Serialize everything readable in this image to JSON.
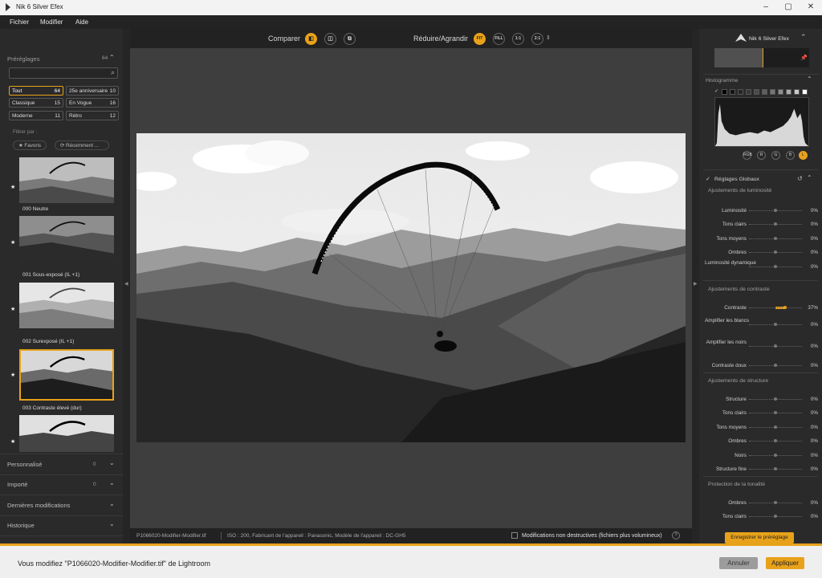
{
  "window": {
    "title": "Nik 6 Silver Efex"
  },
  "menu": [
    "Fichier",
    "Modifier",
    "Aide"
  ],
  "toolbar": {
    "compare_label": "Comparer",
    "zoom_label": "Réduire/Agrandir",
    "zoom_buttons": [
      "FIT",
      "FILL",
      "1:1",
      "2:1"
    ]
  },
  "presets": {
    "title": "Préréglages",
    "count": "64",
    "search_placeholder": "",
    "categories": [
      {
        "label": "Tout",
        "count": "64"
      },
      {
        "label": "25e anniversaire",
        "count": "10"
      },
      {
        "label": "Classique",
        "count": "15"
      },
      {
        "label": "En Vogue",
        "count": "16"
      },
      {
        "label": "Moderne",
        "count": "11"
      },
      {
        "label": "Rétro",
        "count": "12"
      }
    ],
    "filter_label": "Filtrer par :",
    "filter_favorites": "★ Favoris",
    "filter_recent": "⟳ Récemment ...",
    "items": [
      "000 Neutre",
      "001 Sous-exposé (IL +1)",
      "002 Surexposé (IL +1)",
      "003 Contraste élevé (dur)"
    ],
    "sections": [
      {
        "label": "Personnalisé",
        "count": "0"
      },
      {
        "label": "Importé",
        "count": "0"
      },
      {
        "label": "Dernières modifications",
        "count": ""
      },
      {
        "label": "Historique",
        "count": ""
      }
    ]
  },
  "status": {
    "filename": "P1066020-Modifier-Modifier.tif",
    "exif": "ISO : 200, Fabricant de l'appareil : Panasonic, Modèle de l'appareil : DC-GH5",
    "nondestructive": "Modifications non destructives (fichiers plus volumineux)"
  },
  "right": {
    "brand": "Nik 6 Silver Efex",
    "histogram_title": "Histogramme",
    "hist_buttons": [
      "RGB",
      "R",
      "G",
      "B",
      "L"
    ],
    "global_title": "Réglages Globaux",
    "save_preset": "Enregistrer le préréglage",
    "groups": [
      {
        "title": "Ajustements de luminosité",
        "rows": [
          {
            "label": "Luminosité",
            "value": "0%",
            "level": 0
          },
          {
            "label": "Tons clairs",
            "value": "0%",
            "level": 0
          },
          {
            "label": "Tons moyens",
            "value": "0%",
            "level": 0
          },
          {
            "label": "Ombres",
            "value": "0%",
            "level": 0
          },
          {
            "label": "Luminosité dynamique",
            "value": "0%",
            "level": 0
          }
        ]
      },
      {
        "title": "Ajustements de contraste",
        "rows": [
          {
            "label": "Contraste",
            "value": "37%",
            "level": 37
          },
          {
            "label": "Amplifier les blancs",
            "value": "0%",
            "level": 0
          },
          {
            "label": "Amplifier les noirs",
            "value": "0%",
            "level": 0
          },
          {
            "label": "Contraste doux",
            "value": "0%",
            "level": 0
          }
        ]
      },
      {
        "title": "Ajustements de structure",
        "rows": [
          {
            "label": "Structure",
            "value": "0%",
            "level": 0
          },
          {
            "label": "Tons clairs",
            "value": "0%",
            "level": 0
          },
          {
            "label": "Tons moyens",
            "value": "0%",
            "level": 0
          },
          {
            "label": "Ombres",
            "value": "0%",
            "level": 0
          },
          {
            "label": "Noirs",
            "value": "0%",
            "level": 0
          },
          {
            "label": "Structure fine",
            "value": "0%",
            "level": 0
          }
        ]
      },
      {
        "title": "Protection de la tonalité",
        "rows": [
          {
            "label": "Ombres",
            "value": "0%",
            "level": 0
          },
          {
            "label": "Tons clairs",
            "value": "0%",
            "level": 0
          }
        ]
      }
    ]
  },
  "bottom": {
    "message": "Vous modifiez \"P1066020-Modifier-Modifier.tif\" de Lightroom",
    "cancel": "Annuler",
    "apply": "Appliquer"
  },
  "colors": {
    "accent": "#e8a21a",
    "panel": "#2a2a2a",
    "canvas": "#3e3e3e"
  }
}
